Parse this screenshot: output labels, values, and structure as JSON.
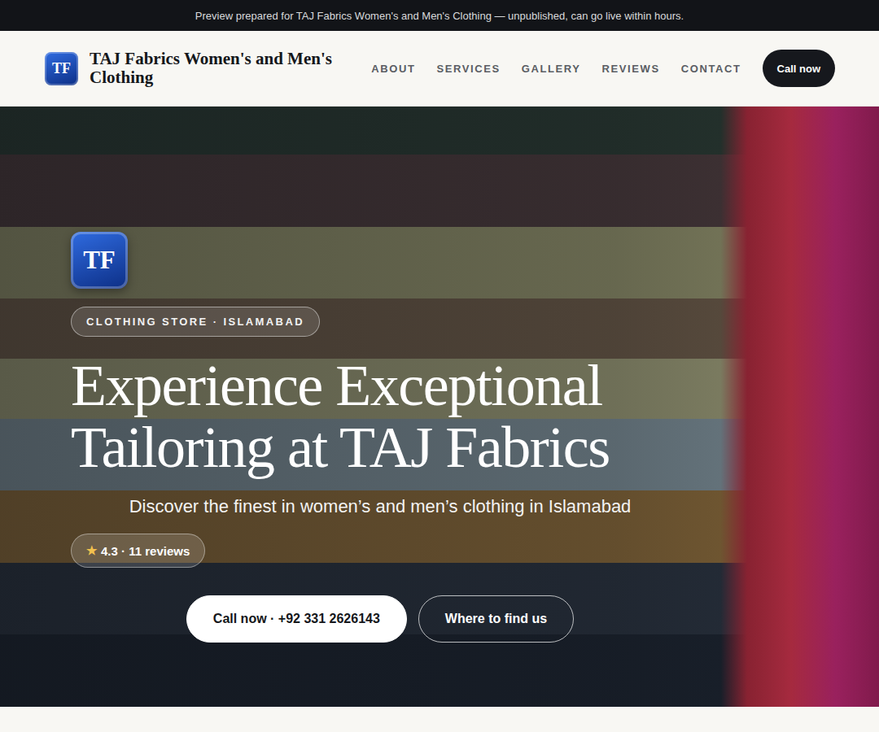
{
  "banner": {
    "text": "Preview prepared for TAJ Fabrics Women's and Men's Clothing — unpublished, can go live within hours."
  },
  "header": {
    "logo": "TF",
    "title": "TAJ Fabrics Women's and Men's Clothing",
    "nav": [
      "ABOUT",
      "SERVICES",
      "GALLERY",
      "REVIEWS",
      "CONTACT"
    ],
    "call_button": "Call now"
  },
  "hero": {
    "logo": "TF",
    "badge": "CLOTHING STORE · ISLAMABAD",
    "headline": "Experience Exceptional Tailoring at TAJ Fabrics",
    "subtitle": "Discover the finest in women’s and men’s clothing in Islamabad",
    "rating": {
      "icon": "★",
      "text": "4.3 · 11 reviews"
    },
    "buttons": [
      "Call now · +92 331 2626143",
      "Where to find us"
    ]
  }
}
